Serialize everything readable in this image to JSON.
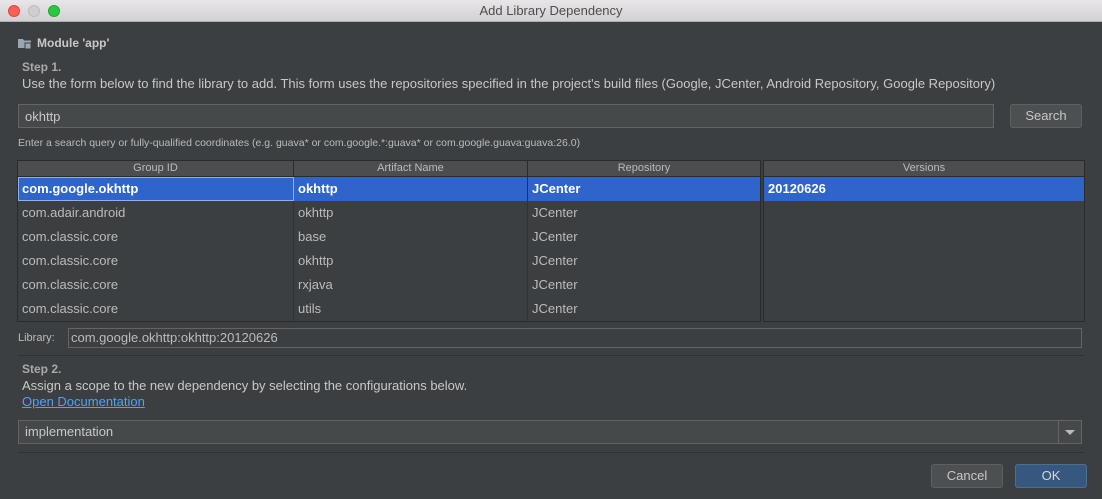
{
  "window": {
    "title": "Add Library Dependency"
  },
  "module": {
    "label": "Module 'app'"
  },
  "step1": {
    "title": "Step 1.",
    "description": "Use the form below to find the library to add. This form uses the repositories specified in the project's build files (Google, JCenter, Android Repository, Google Repository)",
    "search_value": "okhttp",
    "search_button": "Search",
    "hint": "Enter a search query or fully-qualified coordinates (e.g. guava* or com.google.*:guava* or com.google.guava:guava:26.0)"
  },
  "results": {
    "columns": [
      "Group ID",
      "Artifact Name",
      "Repository"
    ],
    "rows": [
      [
        "com.google.okhttp",
        "okhttp",
        "JCenter"
      ],
      [
        "com.adair.android",
        "okhttp",
        "JCenter"
      ],
      [
        "com.classic.core",
        "base",
        "JCenter"
      ],
      [
        "com.classic.core",
        "okhttp",
        "JCenter"
      ],
      [
        "com.classic.core",
        "rxjava",
        "JCenter"
      ],
      [
        "com.classic.core",
        "utils",
        "JCenter"
      ]
    ],
    "selected_index": 0
  },
  "versions": {
    "header": "Versions",
    "items": [
      "20120626"
    ],
    "selected_index": 0
  },
  "library": {
    "label": "Library:",
    "value": "com.google.okhttp:okhttp:20120626"
  },
  "step2": {
    "title": "Step 2.",
    "description": "Assign a scope to the new dependency by selecting the configurations below.",
    "link": "Open Documentation",
    "scope_value": "implementation"
  },
  "buttons": {
    "cancel": "Cancel",
    "ok": "OK"
  },
  "colors": {
    "background": "#3c3f41",
    "selection": "#2f65ca",
    "link": "#589df6",
    "primary_button": "#365880"
  }
}
